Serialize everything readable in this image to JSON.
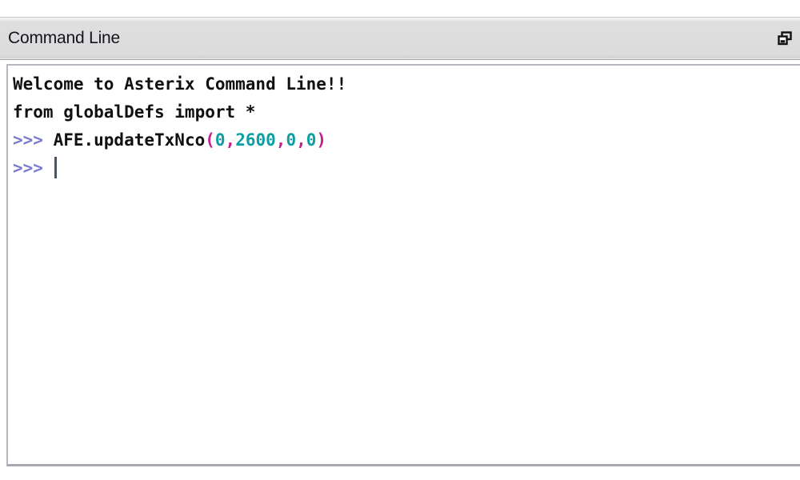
{
  "window": {
    "title": "Command Line",
    "restore_icon": "restore-window-icon",
    "colors": {
      "titlebar_bg": "#dcdcdc",
      "titlebar_text": "#14141e",
      "console_bg": "#ffffff",
      "console_text": "#101010",
      "prompt": "#7b7bd0",
      "punctuation": "#c02090",
      "number": "#0e9fa4",
      "caret": "#4a5560"
    }
  },
  "console": {
    "lines": [
      {
        "id": "line-welcome",
        "tokens": [
          {
            "class": "tok-plain",
            "text": "Welcome to Asterix Command Line!!"
          }
        ]
      },
      {
        "id": "line-import",
        "tokens": [
          {
            "class": "tok-plain",
            "text": "from globalDefs import *"
          }
        ]
      },
      {
        "id": "line-command",
        "tokens": [
          {
            "class": "tok-prompt",
            "text": ">>> "
          },
          {
            "class": "tok-name",
            "text": "AFE.updateTxNco"
          },
          {
            "class": "tok-punct",
            "text": "("
          },
          {
            "class": "tok-number",
            "text": "0"
          },
          {
            "class": "tok-punct",
            "text": ","
          },
          {
            "class": "tok-number",
            "text": "2600"
          },
          {
            "class": "tok-punct",
            "text": ","
          },
          {
            "class": "tok-number",
            "text": "0"
          },
          {
            "class": "tok-punct",
            "text": ","
          },
          {
            "class": "tok-number",
            "text": "0"
          },
          {
            "class": "tok-punct",
            "text": ")"
          }
        ]
      },
      {
        "id": "line-active-prompt",
        "caret": true,
        "tokens": [
          {
            "class": "tok-prompt",
            "text": ">>> "
          }
        ]
      }
    ],
    "input_value": ""
  }
}
